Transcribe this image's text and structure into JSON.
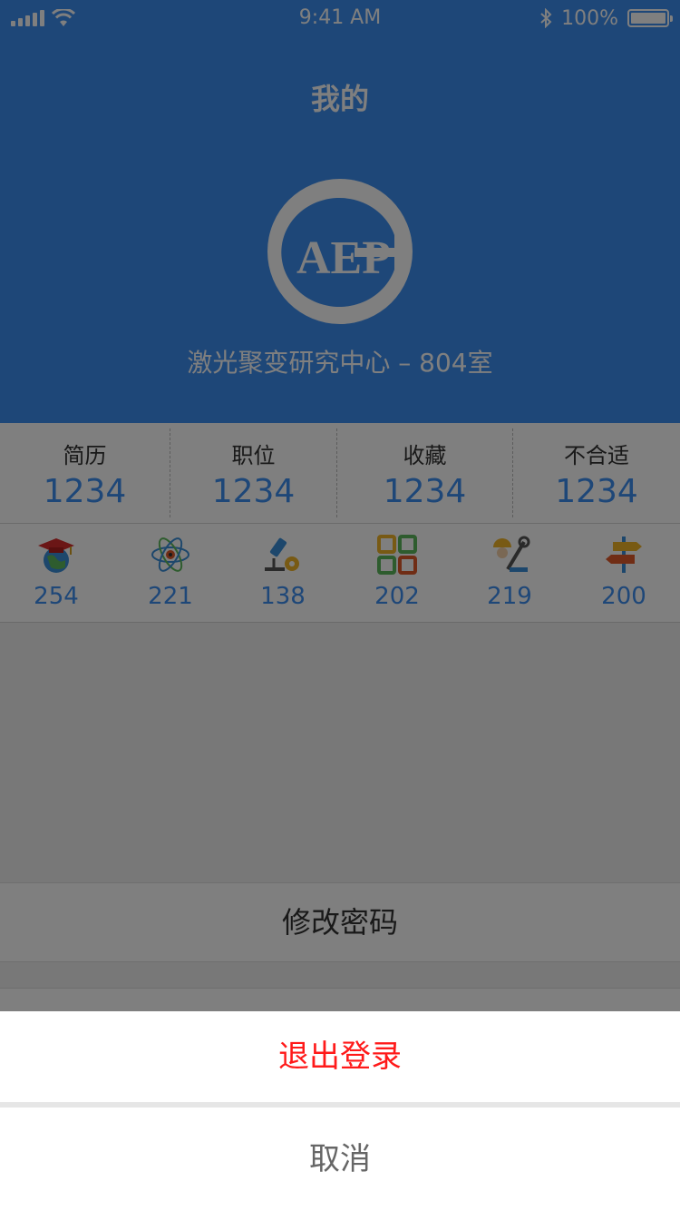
{
  "status_bar": {
    "time": "9:41 AM",
    "battery": "100%",
    "battery_level": 1.0
  },
  "header": {
    "title": "我的",
    "logo_text": "AEP",
    "org_name": "激光聚变研究中心 – 804室"
  },
  "stats": [
    {
      "label": "简历",
      "value": "1234"
    },
    {
      "label": "职位",
      "value": "1234"
    },
    {
      "label": "收藏",
      "value": "1234"
    },
    {
      "label": "不合适",
      "value": "1234"
    }
  ],
  "categories": [
    {
      "icon": "graduation-globe-icon",
      "count": "254"
    },
    {
      "icon": "atom-icon",
      "count": "221"
    },
    {
      "icon": "microscope-gear-icon",
      "count": "138"
    },
    {
      "icon": "grid-squares-icon",
      "count": "202"
    },
    {
      "icon": "engineer-tools-icon",
      "count": "219"
    },
    {
      "icon": "signpost-icon",
      "count": "200"
    }
  ],
  "menu": {
    "change_password": "修改密码"
  },
  "action_sheet": {
    "logout": "退出登录",
    "cancel": "取消"
  },
  "colors": {
    "primary": "#3d8ef0",
    "logout": "#ff1a1a",
    "overlay": "rgba(0,0,0,0.5)"
  }
}
